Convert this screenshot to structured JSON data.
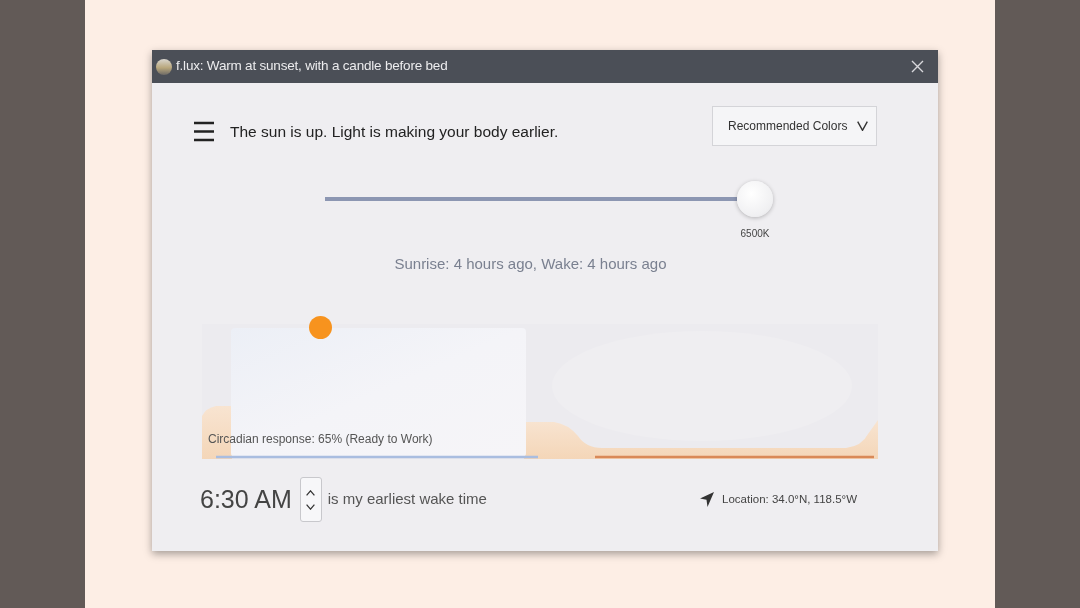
{
  "window": {
    "title": "f.lux: Warm at sunset, with a candle before bed"
  },
  "header": {
    "message": "The sun is up. Light is making your body earlier.",
    "dropdown": {
      "label": "Recommended Colors"
    }
  },
  "color_slider": {
    "level": 1.0,
    "reading": "6500K"
  },
  "sun_times": "Sunrise: 4 hours ago, Wake: 4 hours ago",
  "daylight_chart": {
    "caption": "Circadian response: 65% (Ready to Work)"
  },
  "wake_time": {
    "value": "6:30 AM",
    "caption": "is my earliest wake time"
  },
  "location": {
    "text": "Location: 34.0°N, 118.5°W"
  }
}
